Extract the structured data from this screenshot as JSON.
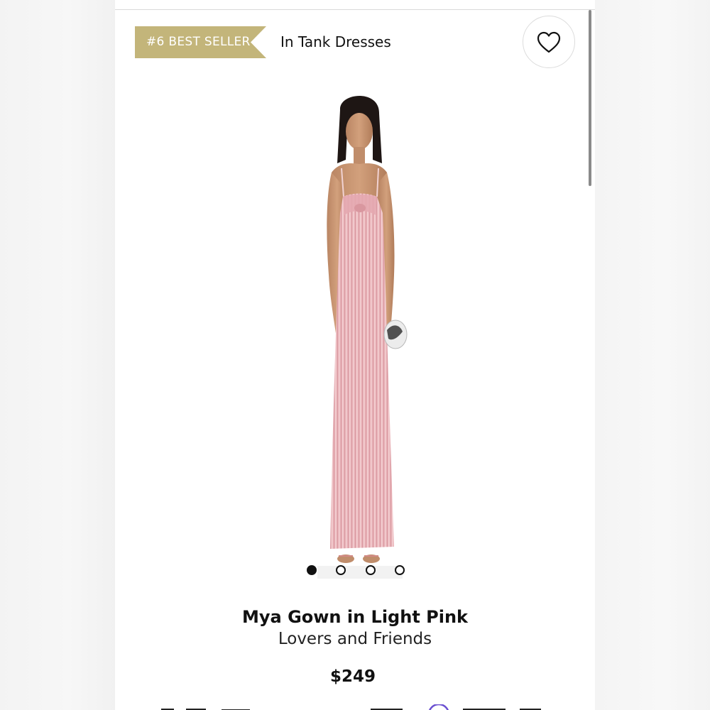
{
  "header": {
    "badge_label": "#6 BEST SELLER",
    "category_label": "In Tank Dresses",
    "favorite_icon": "heart-icon"
  },
  "colors": {
    "badge_bg": "#c3b57a",
    "dress_pink": "#e9b3b8",
    "text_primary": "#111111",
    "accent_partial_icon": "#6a4fd1"
  },
  "gallery": {
    "slide_count": 4,
    "active_slide": 1
  },
  "product": {
    "name": "Mya Gown in Light Pink",
    "brand": "Lovers and Friends",
    "price": "$249"
  }
}
